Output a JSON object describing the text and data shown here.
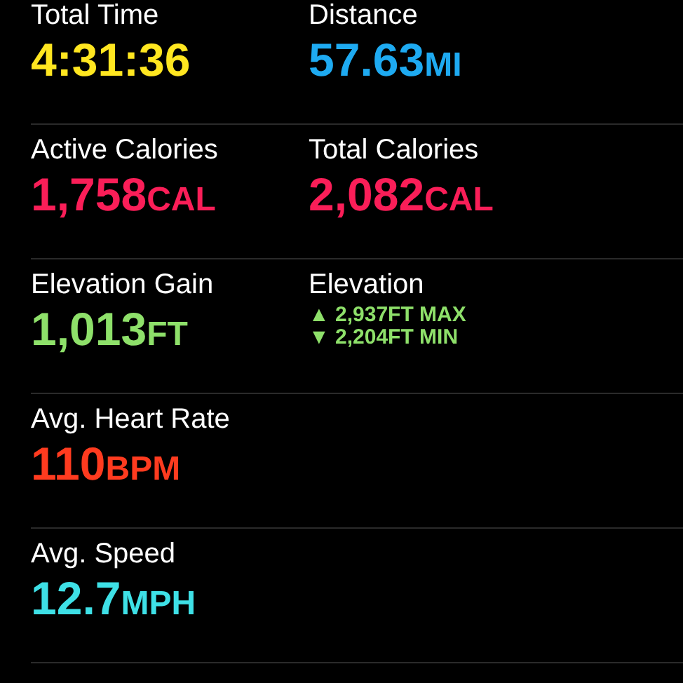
{
  "rows": [
    {
      "metrics": [
        {
          "kind": "value",
          "label": "Total Time",
          "value": "4:31:36",
          "color": "#ffe620"
        },
        {
          "kind": "value",
          "label": "Distance",
          "value": "57.63",
          "unit": "MI",
          "color": "#1eaaf1"
        }
      ]
    },
    {
      "metrics": [
        {
          "kind": "value",
          "label": "Active Calories",
          "value": "1,758",
          "unit": "CAL",
          "color": "#fa1e58"
        },
        {
          "kind": "value",
          "label": "Total Calories",
          "value": "2,082",
          "unit": "CAL",
          "color": "#fa1e58"
        }
      ]
    },
    {
      "metrics": [
        {
          "kind": "value",
          "label": "Elevation Gain",
          "value": "1,013",
          "unit": "FT",
          "color": "#8ee06a"
        },
        {
          "kind": "range",
          "label": "Elevation",
          "color": "#8ee06a",
          "lines": [
            {
              "arrow": "▲",
              "text": "2,937FT MAX"
            },
            {
              "arrow": "▼",
              "text": "2,204FT MIN"
            }
          ]
        }
      ]
    },
    {
      "metrics": [
        {
          "kind": "value",
          "label": "Avg. Heart Rate",
          "value": "110",
          "unit": "BPM",
          "color": "#ff3b1f"
        }
      ]
    },
    {
      "metrics": [
        {
          "kind": "value",
          "label": "Avg. Speed",
          "value": "12.7",
          "unit": "MPH",
          "color": "#3ee0e6"
        }
      ]
    }
  ]
}
